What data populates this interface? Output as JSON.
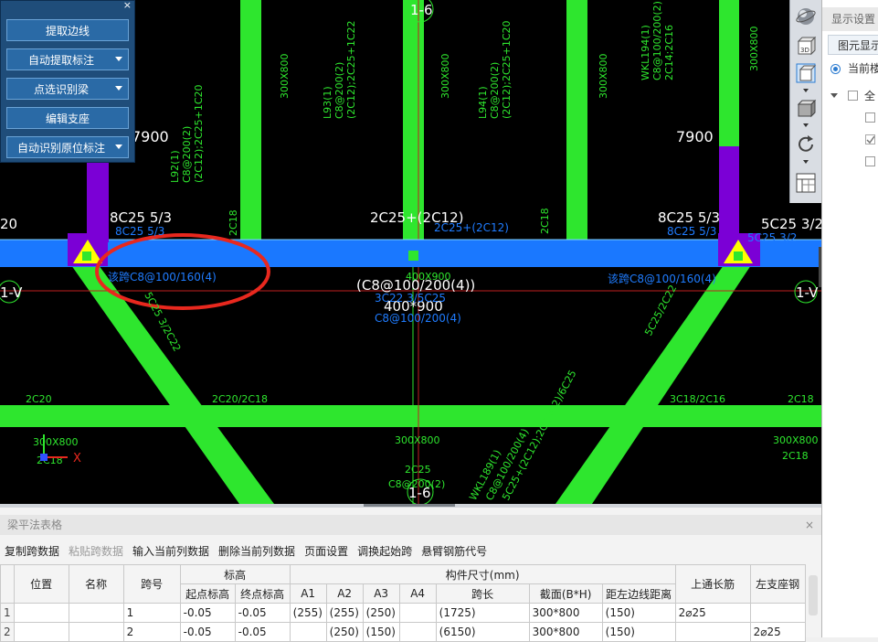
{
  "palette": {
    "close": "×",
    "buttons": [
      {
        "label": "提取边线",
        "dropdown": false
      },
      {
        "label": "自动提取标注",
        "dropdown": true
      },
      {
        "label": "点选识别梁",
        "dropdown": true
      },
      {
        "label": "编辑支座",
        "dropdown": false
      },
      {
        "label": "自动识别原位标注",
        "dropdown": true
      }
    ]
  },
  "view_toolbar": {
    "icons": [
      "sphere-render-icon",
      "3d-view-icon",
      "view-cube-icon",
      "box-view-icon",
      "rotate-icon",
      "grid-settings-icon"
    ],
    "label_3d": "3D"
  },
  "right_panel": {
    "title": "显示设置",
    "tab": "图元显示",
    "radio_label": "当前楼",
    "tree_all": "全"
  },
  "drawing": {
    "axis_top": "1-6",
    "axis_bottom": "1-6",
    "axis_left": "1-V",
    "axis_right": "1-V",
    "dim_left": "7900",
    "dim_right": "7900",
    "text_20": "20",
    "support_left": "8C25 5/3",
    "support_left_small": "8C25 5/3",
    "support_mid": "2C25+(2C12)",
    "support_mid_small": "2C25+(2C12)",
    "support_right": "8C25 5/3",
    "support_right_small": "8C25 5/3",
    "support_far_right": "5C25 3/2",
    "support_far_right_small": "5C25 3/2",
    "stirrup_left": "该跨C8@100/160(4)",
    "stirrup_right": "该跨C8@100/160(4)",
    "stirrup_main": "(C8@100/200(4))",
    "section_main": "400*900",
    "beam_note_a": "3C22 3/5C25",
    "beam_note_b": "C8@100/200(4)",
    "beam_note_c": "400X900",
    "diag_left": "5C25 3/2C22",
    "diag_right": "5C25/2C22",
    "l92_lines": [
      "L92(1)",
      "C8@200(2)",
      "(2C12);2C25+1C20"
    ],
    "l93_lines": [
      "L93(1)",
      "C8@200(2)",
      "(2C12);2C25+1C22"
    ],
    "l94_lines": [
      "L94(1)",
      "C8@200(2)",
      "(2C12);2C25+1C20"
    ],
    "wkl194_lines": [
      "WKL194(1)",
      "C8@100/200(2)",
      "2C14;2C16"
    ],
    "beam_300x800": "300X800",
    "lower_left_2c20": "2C20",
    "lower_mid": "2C20/2C18",
    "lower_right": "3C18/2C16",
    "lower_far_right": "2C18",
    "lower_300x800_mid": "300X800",
    "lower_2c25": "2C25",
    "lower_c8": "C8@200(2)",
    "lower_300x800_right": "300X800",
    "lower_2c18_right": "2C18",
    "lower_left_300": "300X800",
    "lower_left_2c18": "2C18",
    "wkl189": "WKL189(1)",
    "diag_bottom": "C8@100/200(4)",
    "diag_bottom2": "5C25+(2C12);2C20(-2)/6C25",
    "small_2c18_mid": "2C18",
    "small_2c18_left": "2C18",
    "ucs_x": "X"
  },
  "colors": {
    "beam_green": "#2ee62e",
    "beam_blue": "#1a78ff",
    "support_purple": "#7b00d6",
    "highlight_red": "#e8281e",
    "grid_red": "#c02020"
  },
  "bottom_panel": {
    "title": "梁平法表格",
    "close": "×",
    "toolbar": [
      {
        "label": "复制跨数据",
        "enabled": true
      },
      {
        "label": "粘贴跨数据",
        "enabled": false
      },
      {
        "label": "输入当前列数据",
        "enabled": true
      },
      {
        "label": "删除当前列数据",
        "enabled": true
      },
      {
        "label": "页面设置",
        "enabled": true
      },
      {
        "label": "调换起始跨",
        "enabled": true
      },
      {
        "label": "悬臂钢筋代号",
        "enabled": true
      }
    ],
    "headers": {
      "position": "位置",
      "name": "名称",
      "span": "跨号",
      "elevation": "标高",
      "start_elev": "起点标高",
      "end_elev": "终点标高",
      "dims": "构件尺寸(mm)",
      "a1": "A1",
      "a2": "A2",
      "a3": "A3",
      "a4": "A4",
      "span_len": "跨长",
      "section": "截面(B*H)",
      "edge_dist": "距左边线距离",
      "top_through": "上通长筋",
      "left_support": "左支座钢"
    },
    "rows": [
      {
        "num": "1",
        "position": "",
        "name": "",
        "span": "1",
        "start": "-0.05",
        "end": "-0.05",
        "a1": "(255)",
        "a2": "(255)",
        "a3": "(250)",
        "a4": "",
        "len": "(1725)",
        "section": "300*800",
        "edge": "(150)",
        "top": "2⌀25",
        "left": ""
      },
      {
        "num": "2",
        "position": "",
        "name": "",
        "span": "2",
        "start": "-0.05",
        "end": "-0.05",
        "a1": "",
        "a2": "(250)",
        "a3": "(150)",
        "a4": "",
        "len": "(6150)",
        "section": "300*800",
        "edge": "(150)",
        "top": "",
        "left": "2⌀25"
      }
    ]
  }
}
